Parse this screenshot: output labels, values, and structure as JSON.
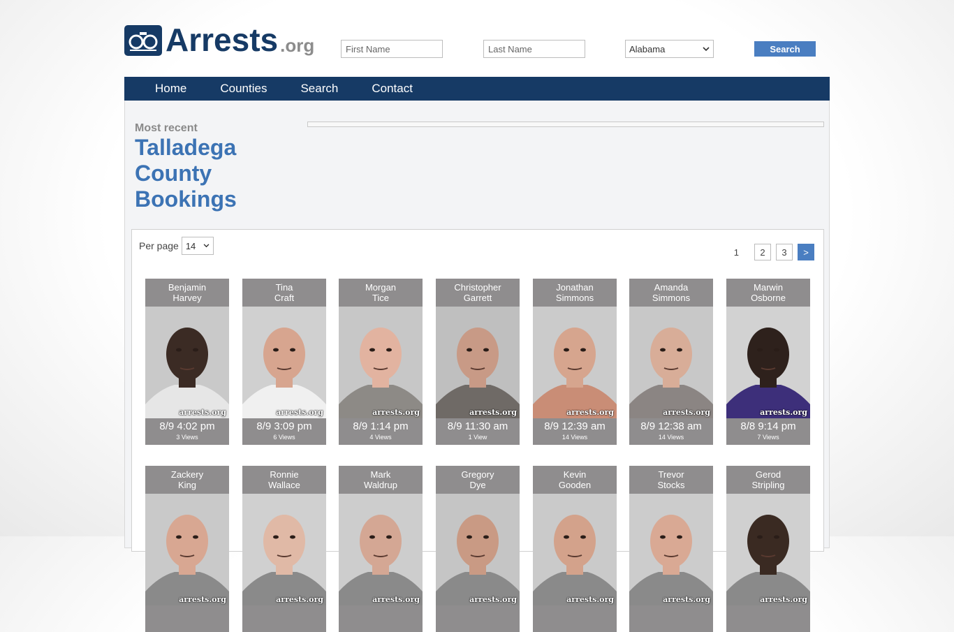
{
  "header": {
    "logo_text": "Arrests",
    "logo_suffix": ".org",
    "first_name_placeholder": "First Name",
    "last_name_placeholder": "Last Name",
    "state_selected": "Alabama",
    "search_label": "Search"
  },
  "nav": {
    "items": [
      {
        "label": "Home"
      },
      {
        "label": "Counties"
      },
      {
        "label": "Search"
      },
      {
        "label": "Contact"
      }
    ]
  },
  "page": {
    "subtitle": "Most recent",
    "title_line1": "Talladega",
    "title_line2": "County",
    "title_line3": "Bookings"
  },
  "controls": {
    "per_page_label": "Per page",
    "per_page_value": "14",
    "current_page": "1",
    "pages": [
      "2",
      "3"
    ],
    "next_label": ">"
  },
  "watermark": "arrests.org",
  "bookings": [
    {
      "first": "Benjamin",
      "last": "Harvey",
      "time": "8/9 4:02 pm",
      "views": "3 Views",
      "skin": "#3b2b24",
      "bg": "#c9c9c9",
      "shirt": "#e6e6e6"
    },
    {
      "first": "Tina",
      "last": "Craft",
      "time": "8/9 3:09 pm",
      "views": "6 Views",
      "skin": "#d7a58f",
      "bg": "#d0d0d0",
      "shirt": "#f0f0f0"
    },
    {
      "first": "Morgan",
      "last": "Tice",
      "time": "8/9 1:14 pm",
      "views": "4 Views",
      "skin": "#e2b3a0",
      "bg": "#c7c7c7",
      "shirt": "#8d8a86"
    },
    {
      "first": "Christopher",
      "last": "Garrett",
      "time": "8/9 11:30 am",
      "views": "1 View",
      "skin": "#c89a86",
      "bg": "#bfbfbf",
      "shirt": "#6f6a66"
    },
    {
      "first": "Jonathan",
      "last": "Simmons",
      "time": "8/9 12:39 am",
      "views": "14 Views",
      "skin": "#d6a58e",
      "bg": "#cbcbcb",
      "shirt": "#c98d76"
    },
    {
      "first": "Amanda",
      "last": "Simmons",
      "time": "8/9 12:38 am",
      "views": "14 Views",
      "skin": "#d8ad98",
      "bg": "#c8c8c8",
      "shirt": "#8b8583"
    },
    {
      "first": "Marwin",
      "last": "Osborne",
      "time": "8/8 9:14 pm",
      "views": "7 Views",
      "skin": "#2e211c",
      "bg": "#d2d2d2",
      "shirt": "#3d2f7a"
    },
    {
      "first": "Zackery",
      "last": "King",
      "time": "",
      "views": "",
      "skin": "#d8a792",
      "bg": "#c9c9c9",
      "shirt": "#8a8a8a"
    },
    {
      "first": "Ronnie",
      "last": "Wallace",
      "time": "",
      "views": "",
      "skin": "#e0b9a6",
      "bg": "#d0d0d0",
      "shirt": "#8a8a8a"
    },
    {
      "first": "Mark",
      "last": "Waldrup",
      "time": "",
      "views": "",
      "skin": "#d4a794",
      "bg": "#cdcdcd",
      "shirt": "#8a8a8a"
    },
    {
      "first": "Gregory",
      "last": "Dye",
      "time": "",
      "views": "",
      "skin": "#c99a84",
      "bg": "#c5c5c5",
      "shirt": "#8a8a8a"
    },
    {
      "first": "Kevin",
      "last": "Gooden",
      "time": "",
      "views": "",
      "skin": "#d3a28b",
      "bg": "#cacaca",
      "shirt": "#8a8a8a"
    },
    {
      "first": "Trevor",
      "last": "Stocks",
      "time": "",
      "views": "",
      "skin": "#d9a994",
      "bg": "#cccccc",
      "shirt": "#8a8a8a"
    },
    {
      "first": "Gerod",
      "last": "Stripling",
      "time": "",
      "views": "",
      "skin": "#3a2a22",
      "bg": "#d0d0d0",
      "shirt": "#8a8a8a"
    }
  ],
  "icons": {
    "logo": "handcuffs-badge-icon",
    "select_arrow": "chevron-down-icon"
  },
  "colors": {
    "brand_navy": "#163a65",
    "accent_blue": "#4a7ec1",
    "title_blue": "#3c73b4",
    "card_gray": "#8f8d8e"
  }
}
